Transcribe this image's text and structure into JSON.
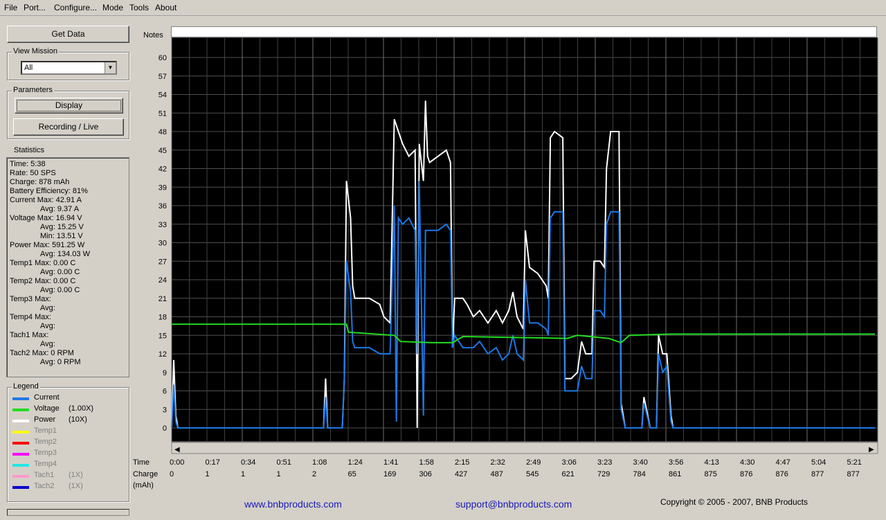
{
  "menu": [
    "File",
    "Port...",
    "Configure...",
    "Mode",
    "Tools",
    "About"
  ],
  "buttons": {
    "get_data": "Get Data",
    "display": "Display",
    "recording": "Recording / Live"
  },
  "view_mission": {
    "title": "View Mission",
    "selected": "All"
  },
  "parameters_title": "Parameters",
  "statistics": {
    "title": "Statistics",
    "lines": [
      "Time: 5:38",
      "Rate: 50 SPS",
      "Charge: 878 mAh",
      "Battery Efficiency: 81%",
      "Current Max: 42.91 A",
      "Avg: 9.37 A",
      "Voltage Max: 16.94 V",
      "Avg: 15.25 V",
      "Min: 13.51 V",
      "Power Max: 591.25 W",
      "Avg: 134.03 W",
      "Temp1 Max: 0.00 C",
      "Avg: 0.00 C",
      "Temp2 Max: 0.00 C",
      "Avg: 0.00 C",
      "Temp3 Max:",
      "Avg:",
      "Temp4 Max:",
      "Avg:",
      "Tach1 Max:",
      "Avg:",
      "Tach2 Max: 0 RPM",
      "Avg: 0 RPM"
    ]
  },
  "legend": {
    "title": "Legend",
    "items": [
      {
        "label": "Current",
        "scale": "",
        "color": "#1e78e6",
        "enabled": true
      },
      {
        "label": "Voltage",
        "scale": "(1.00X)",
        "color": "#22dd22",
        "enabled": true
      },
      {
        "label": "Power",
        "scale": "(10X)",
        "color": "#ffffff",
        "enabled": true
      },
      {
        "label": "Temp1",
        "scale": "",
        "color": "#ffff00",
        "enabled": false
      },
      {
        "label": "Temp2",
        "scale": "",
        "color": "#ff0000",
        "enabled": false
      },
      {
        "label": "Temp3",
        "scale": "",
        "color": "#ff00ff",
        "enabled": false
      },
      {
        "label": "Temp4",
        "scale": "",
        "color": "#22e6e6",
        "enabled": false
      },
      {
        "label": "Tach1",
        "scale": "(1X)",
        "color": "#ff99cc",
        "enabled": false
      },
      {
        "label": "Tach2",
        "scale": "(1X)",
        "color": "#0000cc",
        "enabled": false
      }
    ]
  },
  "notes_label": "Notes",
  "axis": {
    "time_label": "Time",
    "charge_label": "Charge",
    "charge_unit": "(mAh)",
    "time_ticks": [
      "0:00",
      "0:17",
      "0:34",
      "0:51",
      "1:08",
      "1:24",
      "1:41",
      "1:58",
      "2:15",
      "2:32",
      "2:49",
      "3:06",
      "3:23",
      "3:40",
      "3:56",
      "4:13",
      "4:30",
      "4:47",
      "5:04",
      "5:21"
    ],
    "charge_ticks": [
      "0",
      "1",
      "1",
      "1",
      "2",
      "65",
      "169",
      "306",
      "427",
      "487",
      "545",
      "621",
      "729",
      "784",
      "861",
      "875",
      "876",
      "876",
      "877",
      "877"
    ]
  },
  "footer": {
    "website": "www.bnbproducts.com",
    "support": "support@bnbproducts.com",
    "copyright": "Copyright © 2005 - 2007, BNB Products"
  },
  "chart_data": {
    "type": "line",
    "ylim": [
      0,
      62
    ],
    "y_ticks": [
      0,
      3,
      6,
      9,
      12,
      15,
      18,
      21,
      24,
      27,
      30,
      33,
      36,
      39,
      42,
      45,
      48,
      51,
      54,
      57,
      60
    ],
    "xlim": [
      0,
      338
    ],
    "grid": true,
    "series": [
      {
        "name": "Power",
        "color": "#ffffff",
        "points": [
          [
            0,
            0
          ],
          [
            1,
            11
          ],
          [
            2,
            2
          ],
          [
            3,
            0
          ],
          [
            70,
            0
          ],
          [
            73,
            0
          ],
          [
            74,
            8
          ],
          [
            75,
            0
          ],
          [
            82,
            0
          ],
          [
            83,
            8
          ],
          [
            84,
            40
          ],
          [
            86,
            34
          ],
          [
            87,
            23
          ],
          [
            88,
            21
          ],
          [
            95,
            21
          ],
          [
            100,
            20
          ],
          [
            102,
            18
          ],
          [
            105,
            17
          ],
          [
            107,
            50
          ],
          [
            109,
            48
          ],
          [
            111,
            46
          ],
          [
            114,
            44
          ],
          [
            117,
            45
          ],
          [
            118,
            0
          ],
          [
            119,
            46
          ],
          [
            121,
            40
          ],
          [
            122,
            53
          ],
          [
            123,
            44
          ],
          [
            124,
            43
          ],
          [
            128,
            44
          ],
          [
            132,
            45
          ],
          [
            134,
            43
          ],
          [
            135,
            13
          ],
          [
            136,
            21
          ],
          [
            140,
            21
          ],
          [
            142,
            20
          ],
          [
            145,
            18
          ],
          [
            148,
            19
          ],
          [
            152,
            17
          ],
          [
            156,
            19
          ],
          [
            159,
            17
          ],
          [
            162,
            19
          ],
          [
            164,
            22
          ],
          [
            166,
            18
          ],
          [
            169,
            16
          ],
          [
            170,
            32
          ],
          [
            172,
            26
          ],
          [
            176,
            25
          ],
          [
            180,
            23
          ],
          [
            181,
            21
          ],
          [
            182,
            47
          ],
          [
            184,
            48
          ],
          [
            188,
            47
          ],
          [
            189,
            8
          ],
          [
            192,
            8
          ],
          [
            195,
            9
          ],
          [
            197,
            14
          ],
          [
            199,
            12
          ],
          [
            202,
            12
          ],
          [
            203,
            27
          ],
          [
            206,
            27
          ],
          [
            208,
            26
          ],
          [
            209,
            42
          ],
          [
            211,
            48
          ],
          [
            215,
            48
          ],
          [
            216,
            4
          ],
          [
            218,
            0
          ],
          [
            226,
            0
          ],
          [
            227,
            5
          ],
          [
            230,
            0
          ],
          [
            233,
            0
          ],
          [
            234,
            15
          ],
          [
            236,
            12
          ],
          [
            238,
            12
          ],
          [
            240,
            2
          ],
          [
            241,
            0
          ],
          [
            338,
            0
          ]
        ]
      },
      {
        "name": "Current",
        "color": "#1e78e6",
        "points": [
          [
            0,
            0
          ],
          [
            1,
            7
          ],
          [
            2,
            1
          ],
          [
            3,
            0
          ],
          [
            70,
            0
          ],
          [
            73,
            0
          ],
          [
            74,
            5
          ],
          [
            75,
            0
          ],
          [
            82,
            0
          ],
          [
            83,
            8
          ],
          [
            84,
            27
          ],
          [
            86,
            22
          ],
          [
            87,
            14
          ],
          [
            88,
            13
          ],
          [
            95,
            13
          ],
          [
            100,
            12
          ],
          [
            102,
            12
          ],
          [
            105,
            12
          ],
          [
            107,
            36
          ],
          [
            108,
            1
          ],
          [
            109,
            34
          ],
          [
            111,
            33
          ],
          [
            114,
            34
          ],
          [
            117,
            32
          ],
          [
            118,
            12
          ],
          [
            119,
            40
          ],
          [
            121,
            2
          ],
          [
            122,
            32
          ],
          [
            123,
            32
          ],
          [
            128,
            32
          ],
          [
            132,
            33
          ],
          [
            134,
            32
          ],
          [
            135,
            13
          ],
          [
            136,
            15
          ],
          [
            140,
            13
          ],
          [
            142,
            13
          ],
          [
            145,
            13
          ],
          [
            148,
            14
          ],
          [
            152,
            12
          ],
          [
            156,
            13
          ],
          [
            159,
            11
          ],
          [
            162,
            12
          ],
          [
            164,
            15
          ],
          [
            166,
            12
          ],
          [
            169,
            11
          ],
          [
            170,
            24
          ],
          [
            172,
            17
          ],
          [
            176,
            17
          ],
          [
            180,
            16
          ],
          [
            181,
            15
          ],
          [
            182,
            34
          ],
          [
            184,
            35
          ],
          [
            188,
            35
          ],
          [
            189,
            6
          ],
          [
            192,
            6
          ],
          [
            195,
            6
          ],
          [
            197,
            10
          ],
          [
            199,
            8
          ],
          [
            202,
            8
          ],
          [
            203,
            19
          ],
          [
            206,
            19
          ],
          [
            208,
            18
          ],
          [
            209,
            33
          ],
          [
            211,
            35
          ],
          [
            215,
            35
          ],
          [
            216,
            3
          ],
          [
            218,
            0
          ],
          [
            226,
            0
          ],
          [
            227,
            4
          ],
          [
            230,
            0
          ],
          [
            233,
            0
          ],
          [
            234,
            12
          ],
          [
            236,
            9
          ],
          [
            238,
            10
          ],
          [
            240,
            1
          ],
          [
            241,
            0
          ],
          [
            338,
            0
          ]
        ]
      },
      {
        "name": "Voltage",
        "color": "#22dd22",
        "points": [
          [
            0,
            16.8
          ],
          [
            84,
            16.8
          ],
          [
            85,
            15.5
          ],
          [
            107,
            15.0
          ],
          [
            110,
            14.0
          ],
          [
            125,
            13.8
          ],
          [
            135,
            13.8
          ],
          [
            140,
            14.8
          ],
          [
            190,
            14.5
          ],
          [
            195,
            15.0
          ],
          [
            210,
            14.5
          ],
          [
            216,
            13.8
          ],
          [
            220,
            15.0
          ],
          [
            240,
            15.2
          ],
          [
            338,
            15.2
          ]
        ]
      }
    ]
  }
}
